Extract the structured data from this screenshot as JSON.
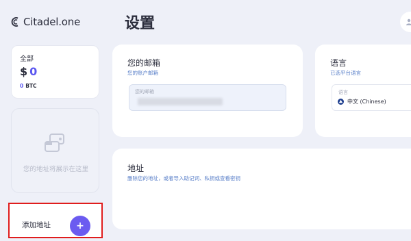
{
  "app": {
    "name": "Citadel.one"
  },
  "header": {
    "title": "设置"
  },
  "sidebar": {
    "balance": {
      "label": "全部",
      "currency_symbol": "$",
      "usd_value": "0",
      "btc_value": "0",
      "btc_unit": "BTC"
    },
    "empty_state": {
      "text": "您的地址将展示在这里"
    },
    "add_address": {
      "label": "添加地址",
      "button_symbol": "+"
    }
  },
  "settings": {
    "email": {
      "title": "您的邮箱",
      "subtitle": "您的账户邮箱",
      "field_label": "您的邮箱"
    },
    "language": {
      "title": "语言",
      "subtitle": "已选平台语言",
      "field_label": "语言",
      "selected": "中文 (Chinese)"
    },
    "address": {
      "title": "地址",
      "subtitle": "删除您的地址，或者导入助记词、私钥或查看密钥"
    }
  },
  "colors": {
    "accent": "#5b57f0",
    "button": "#6b5bf0",
    "highlight_border": "#e01d1d",
    "subtitle": "#5b80c9",
    "background": "#eef0f8"
  },
  "icons": [
    "citadel-logo-icon",
    "wallet-icon",
    "plus-icon",
    "user-icon",
    "globe-icon"
  ]
}
